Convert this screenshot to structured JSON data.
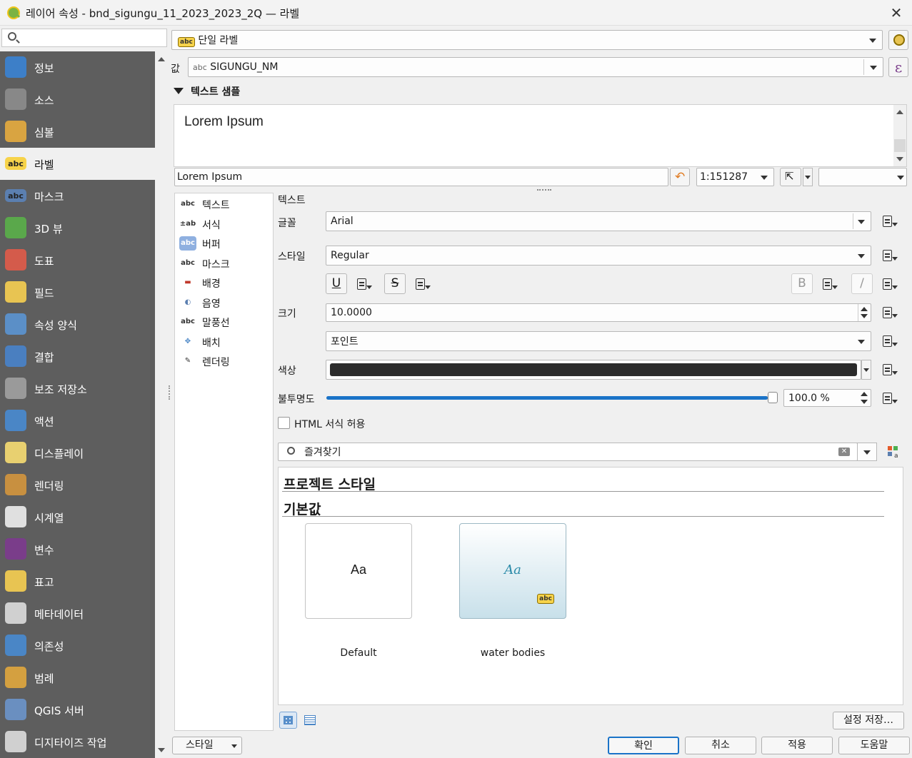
{
  "window": {
    "title": "레이어 속성 - bnd_sigungu_11_2023_2023_2Q — 라벨",
    "close": "✕"
  },
  "sidebar": {
    "search_placeholder": "",
    "items": [
      {
        "label": "정보",
        "icon": "info-icon",
        "color": "#3d7fc8"
      },
      {
        "label": "소스",
        "icon": "wrench-icon",
        "color": "#888888"
      },
      {
        "label": "심볼",
        "icon": "paintbrush-icon",
        "color": "#d9a441"
      },
      {
        "label": "라벨",
        "icon": "abc-label-icon",
        "color": "#f7d34a"
      },
      {
        "label": "마스크",
        "icon": "abc-mask-icon",
        "color": "#5b7fb0"
      },
      {
        "label": "3D 뷰",
        "icon": "cube-icon",
        "color": "#5aa84b"
      },
      {
        "label": "도표",
        "icon": "chart-icon",
        "color": "#d45b4b"
      },
      {
        "label": "필드",
        "icon": "fields-icon",
        "color": "#e8c452"
      },
      {
        "label": "속성 양식",
        "icon": "form-icon",
        "color": "#5b8fc7"
      },
      {
        "label": "결합",
        "icon": "join-icon",
        "color": "#4a7fc0"
      },
      {
        "label": "보조 저장소",
        "icon": "database-icon",
        "color": "#9a9a9a"
      },
      {
        "label": "액션",
        "icon": "action-gear-icon",
        "color": "#4a86c6"
      },
      {
        "label": "디스플레이",
        "icon": "speech-bubble-icon",
        "color": "#e8d070"
      },
      {
        "label": "렌더링",
        "icon": "render-brush-icon",
        "color": "#c89040"
      },
      {
        "label": "시계열",
        "icon": "clock-icon",
        "color": "#e0e0e0"
      },
      {
        "label": "변수",
        "icon": "epsilon-icon",
        "color": "#7a3d8a"
      },
      {
        "label": "표고",
        "icon": "elevation-icon",
        "color": "#e8c452"
      },
      {
        "label": "메타데이터",
        "icon": "metadata-icon",
        "color": "#d0d0d0"
      },
      {
        "label": "의존성",
        "icon": "dependency-icon",
        "color": "#4a86c6"
      },
      {
        "label": "범례",
        "icon": "legend-icon",
        "color": "#d4a040"
      },
      {
        "label": "QGIS 서버",
        "icon": "server-icon",
        "color": "#6a8fc0"
      },
      {
        "label": "디지타이즈 작업",
        "icon": "digitize-icon",
        "color": "#d0d0d0"
      }
    ]
  },
  "top": {
    "mode": "단일 라벨",
    "value_label": "값",
    "value_type": "abc",
    "value": "SIGUNGU_NM",
    "expr_icon": "ε"
  },
  "sample": {
    "header": "텍스트 샘플",
    "preview_text": "Lorem Ipsum",
    "input_text": "Lorem Ipsum",
    "scale": "1:151287"
  },
  "label_tabs": [
    "텍스트",
    "서식",
    "버퍼",
    "마스크",
    "배경",
    "음영",
    "말풍선",
    "배치",
    "렌더링"
  ],
  "text_panel": {
    "section": "텍스트",
    "font_label": "글꼴",
    "font_value": "Arial",
    "style_label": "스타일",
    "style_value": "Regular",
    "underline": "U",
    "strike": "S",
    "bold": "B",
    "italic": "/",
    "size_label": "크기",
    "size_value": "10.0000",
    "unit_value": "포인트",
    "color_label": "색상",
    "color_value": "#2b2b2b",
    "opacity_label": "불투명도",
    "opacity_value": "100.0 %",
    "opacity_fraction": 1.0,
    "html_label": "HTML 서식 허용"
  },
  "gallery": {
    "search_value": "즐겨찾기",
    "section_project": "프로젝트 스타일",
    "section_default": "기본값",
    "tiles": [
      {
        "sample": "Aa",
        "name": "Default"
      },
      {
        "sample": "Aa",
        "name": "water bodies"
      }
    ],
    "save_button": "설정 저장…"
  },
  "footer": {
    "style_button": "스타일",
    "ok": "확인",
    "cancel": "취소",
    "apply": "적용",
    "help": "도움말"
  }
}
